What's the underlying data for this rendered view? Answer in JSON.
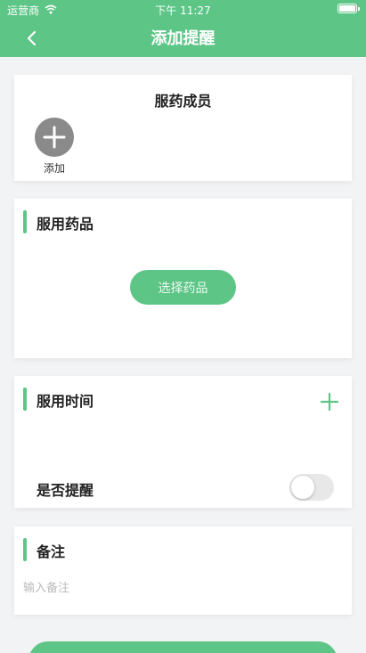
{
  "status_bar": {
    "carrier": "运营商",
    "time": "下午 11:27"
  },
  "nav": {
    "title": "添加提醒"
  },
  "member_card": {
    "title": "服药成员",
    "add_label": "添加"
  },
  "medicine_card": {
    "title": "服用药品",
    "select_button": "选择药品"
  },
  "time_card": {
    "title": "服用时间",
    "remind_label": "是否提醒",
    "remind_enabled": false
  },
  "remark_card": {
    "title": "备注",
    "placeholder": "输入备注"
  },
  "colors": {
    "accent": "#5dc586",
    "background": "#f2f3f5",
    "card": "#ffffff"
  }
}
